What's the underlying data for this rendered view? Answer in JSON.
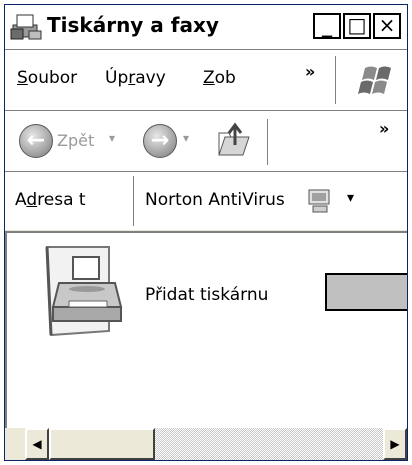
{
  "window": {
    "title": "Tiskárny a faxy",
    "title_icon": "printer-fax-icon",
    "controls": [
      "_",
      "□",
      "×"
    ]
  },
  "menubar": {
    "items": [
      {
        "label": "Soubor",
        "mnemonic": "S"
      },
      {
        "label": "Úpravy",
        "mnemonic": "r"
      },
      {
        "label": "Zob",
        "mnemonic": "Z"
      }
    ],
    "overflow": "»",
    "logo": "windows-logo-icon"
  },
  "toolbar": {
    "back_label": "Zpět",
    "back_icon": "back-arrow-icon",
    "forward_icon": "forward-arrow-icon",
    "up_icon": "up-folder-icon",
    "overflow": "»"
  },
  "addressbar": {
    "label": "Adresa t",
    "mnemonic": "d",
    "norton_label": "Norton AntiVirus",
    "norton_icon": "norton-antivirus-icon"
  },
  "content": {
    "items": [
      {
        "label": "Přidat tiskárnu",
        "icon": "add-printer-icon"
      }
    ]
  },
  "scrollbar": {
    "left_arrow": "◀",
    "right_arrow": "▶"
  }
}
